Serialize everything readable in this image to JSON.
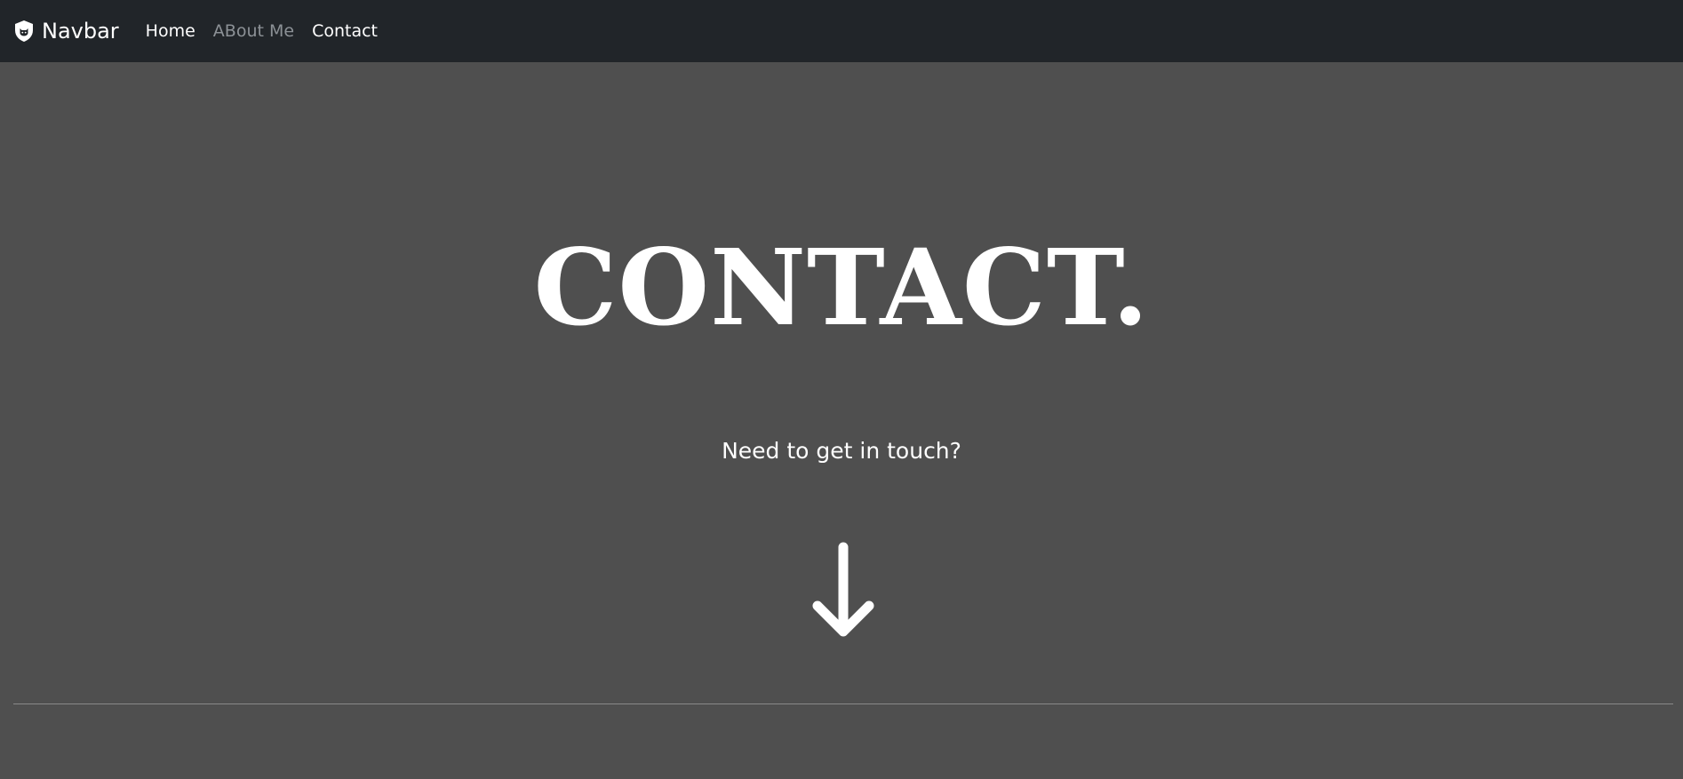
{
  "navbar": {
    "brand_label": "Navbar",
    "brand_icon": "shield-cat-icon",
    "links": [
      {
        "label": "Home",
        "state": "active"
      },
      {
        "label": "ABout Me",
        "state": "muted"
      },
      {
        "label": "Contact",
        "state": "normal"
      }
    ]
  },
  "hero": {
    "title": "CONTACT.",
    "subtitle": "Need to get in touch?",
    "arrow_icon": "arrow-down-icon"
  },
  "colors": {
    "navbar_bg": "#212529",
    "page_bg": "#4f4f4f",
    "text": "#ffffff",
    "muted_link": "#8c9196",
    "divider": "#8a8a8a"
  }
}
